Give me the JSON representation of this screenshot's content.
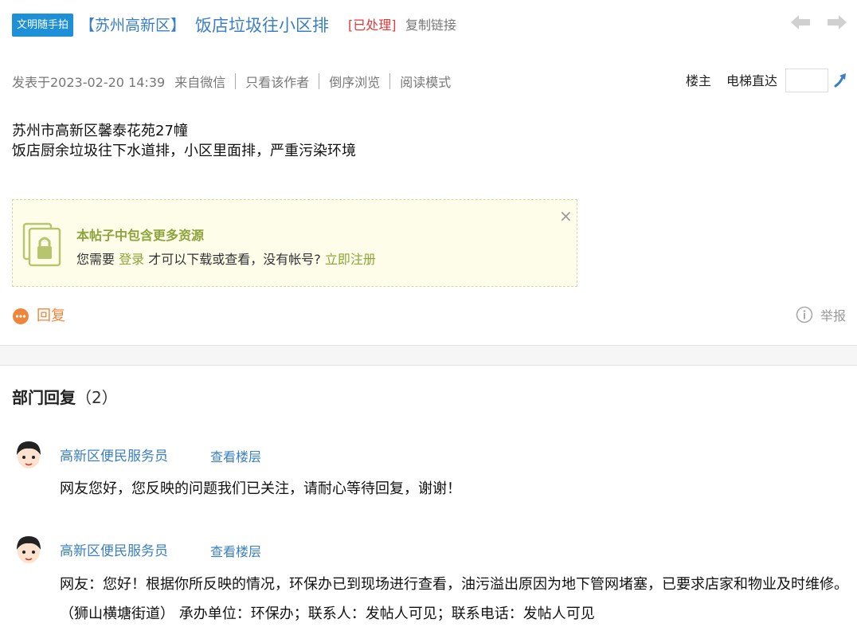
{
  "header": {
    "badge": "文明随手拍",
    "region": "【苏州高新区】",
    "title": "饭店垃圾往小区排",
    "status": "[已处理]",
    "copy_link": "复制链接"
  },
  "meta": {
    "posted": "发表于2023-02-20 14:39",
    "source": "来自微信",
    "author_only": "只看该作者",
    "reverse": "倒序浏览",
    "read_mode": "阅读模式",
    "louzhu": "楼主",
    "elevator": "电梯直达",
    "floor_value": ""
  },
  "post": {
    "line1": "苏州市高新区馨泰花苑27幢",
    "line2": "饭店厨余垃圾往下水道排，小区里面排，严重污染环境"
  },
  "resource": {
    "title": "本帖子中包含更多资源",
    "prefix": "您需要",
    "login": "登录",
    "middle": "才可以下载或查看，没有帐号?",
    "register": "立即注册",
    "close": "×"
  },
  "actions": {
    "reply": "回复",
    "report": "举报"
  },
  "replies": {
    "title": "部门回复",
    "count": "（2）",
    "items": [
      {
        "name": "高新区便民服务员",
        "view": "查看楼层",
        "text": "网友您好，您反映的问题我们已关注，请耐心等待回复，谢谢！"
      },
      {
        "name": "高新区便民服务员",
        "view": "查看楼层",
        "text": "网友：您好！根据你所反映的情况，环保办已到现场进行查看，油污溢出原因为地下管网堵塞，已要求店家和物业及时维修。（狮山横塘街道） 承办单位：环保办；联系人：发帖人可见；联系电话：发帖人可见"
      }
    ]
  },
  "colors": {
    "accent_blue": "#3a7fc1",
    "badge_blue": "#1e90d8",
    "status_red": "#e03a3a",
    "reply_orange": "#f0863a",
    "resource_green": "#8ea43c"
  },
  "icons": [
    "arrow-left-icon",
    "arrow-right-icon",
    "go-icon",
    "lock-icon",
    "reply-bubble-icon",
    "info-icon",
    "avatar"
  ]
}
